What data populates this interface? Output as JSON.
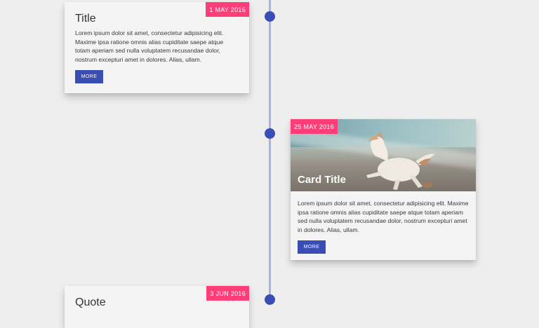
{
  "timeline": [
    {
      "date": "1 MAY 2016",
      "title": "Title",
      "body": "Lorem ipsum dolor sit amet, consectetur adipisicing elit. Maxime ipsa ratione omnis alias cupiditate saepe atque totam aperiam sed nulla voluptatem recusandae dolor, nostrum excepturi amet in dolores. Alias, ullam.",
      "button": "MORE"
    },
    {
      "date": "25 MAY 2016",
      "title": "Card Title",
      "body": "Lorem ipsum dolor sit amet, consectetur adipisicing elit. Maxime ipsa ratione omnis alias cupiditate saepe atque totam aperiam sed nulla voluptatem recusandae dolor, nostrum excepturi amet in dolores. Alias, ullam.",
      "button": "MORE"
    },
    {
      "date": "3 JUN 2016",
      "title": "Quote"
    }
  ],
  "colors": {
    "background": "#eeeeee",
    "accent": "#3a4db5",
    "date_badge": "#ff3d78",
    "timeline_line": "#aab0e6"
  }
}
